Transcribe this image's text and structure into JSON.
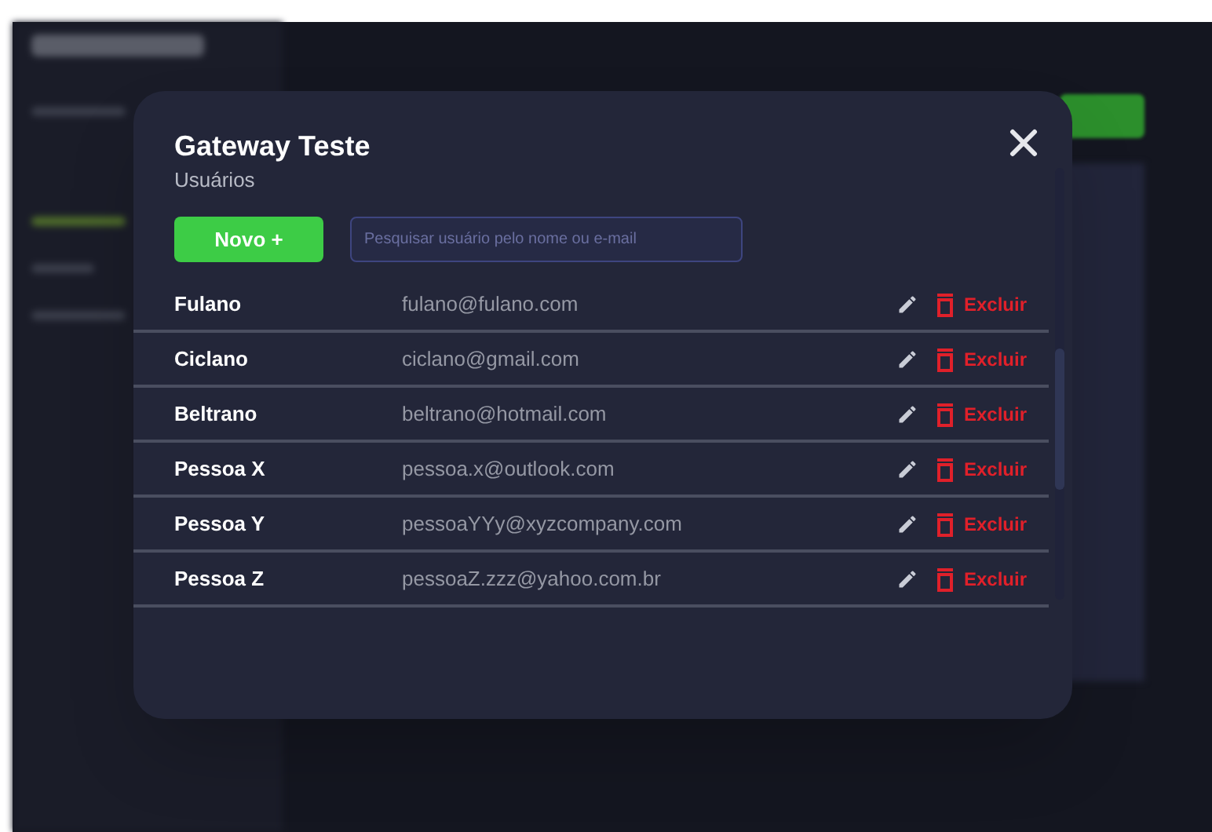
{
  "modal": {
    "title": "Gateway Teste",
    "subtitle": "Usuários",
    "new_button": "Novo +",
    "search": {
      "placeholder": "Pesquisar usuário pelo nome ou e-mail"
    },
    "users": [
      {
        "name": "Fulano",
        "email": "fulano@fulano.com",
        "delete": "Excluir"
      },
      {
        "name": "Ciclano",
        "email": "ciclano@gmail.com",
        "delete": "Excluir"
      },
      {
        "name": "Beltrano",
        "email": "beltrano@hotmail.com",
        "delete": "Excluir"
      },
      {
        "name": "Pessoa X",
        "email": "pessoa.x@outlook.com",
        "delete": "Excluir"
      },
      {
        "name": "Pessoa Y",
        "email": "pessoaYYy@xyzcompany.com",
        "delete": "Excluir"
      },
      {
        "name": "Pessoa Z",
        "email": "pessoaZ.zzz@yahoo.com.br",
        "delete": "Excluir"
      }
    ]
  }
}
